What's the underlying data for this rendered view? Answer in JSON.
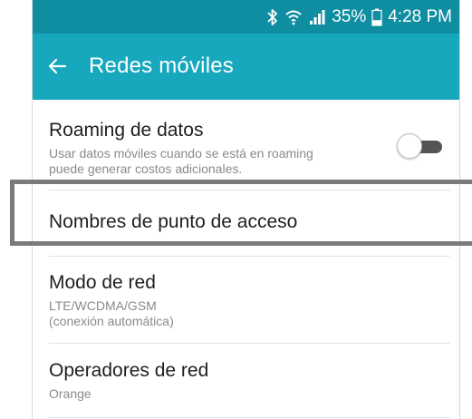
{
  "status_bar": {
    "battery_percent_text": "35%",
    "time": "4:28 PM",
    "battery_level": 0.35,
    "icons": [
      "bluetooth-icon",
      "wifi-icon",
      "signal-icon",
      "battery-icon"
    ]
  },
  "app_bar": {
    "back_icon": "arrow-left-icon",
    "title": "Redes móviles"
  },
  "settings": {
    "roaming": {
      "title": "Roaming de datos",
      "summary_line1": "Usar datos móviles cuando se está en roaming",
      "summary_line2": "puede generar costos adicionales.",
      "enabled": false
    },
    "apn": {
      "title": "Nombres de punto de acceso"
    },
    "network_mode": {
      "title": "Modo de red",
      "summary_line1": "LTE/WCDMA/GSM",
      "summary_line2": "(conexión automática)"
    },
    "operators": {
      "title": "Operadores de red",
      "summary": "Orange"
    }
  },
  "colors": {
    "status_bar": "#0f8ea2",
    "app_bar": "#17a8bd",
    "highlight_border": "#7b7b7b"
  }
}
